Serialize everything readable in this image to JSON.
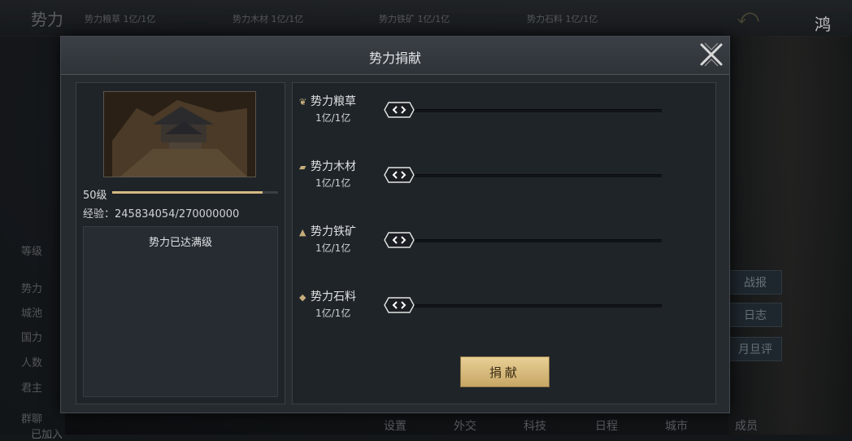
{
  "topbar": {
    "title": "势力",
    "resources": [
      {
        "name": "势力粮草",
        "value": "1亿/1亿"
      },
      {
        "name": "势力木材",
        "value": "1亿/1亿"
      },
      {
        "name": "势力铁矿",
        "value": "1亿/1亿"
      },
      {
        "name": "势力石料",
        "value": "1亿/1亿"
      }
    ]
  },
  "left_panel": {
    "labels": [
      "等级",
      "势力",
      "城池",
      "国力",
      "人数",
      "君主",
      "群聊"
    ],
    "group_chat_value": "已加入"
  },
  "side_buttons": [
    "战报",
    "日志",
    "月旦评"
  ],
  "bottom_nav": [
    "设置",
    "外交",
    "科技",
    "日程",
    "城市",
    "成员"
  ],
  "modal": {
    "title": "势力捐献",
    "level_label": "50级",
    "level_progress": 0.908,
    "exp_label": "经验：245834054/270000000",
    "status_text": "势力已达满级",
    "resources": [
      {
        "name": "势力粮草",
        "amount": "1亿/1亿",
        "icon": "grain-icon"
      },
      {
        "name": "势力木材",
        "amount": "1亿/1亿",
        "icon": "wood-icon"
      },
      {
        "name": "势力铁矿",
        "amount": "1亿/1亿",
        "icon": "iron-icon"
      },
      {
        "name": "势力石料",
        "amount": "1亿/1亿",
        "icon": "stone-icon"
      }
    ],
    "donate_label": "捐献"
  },
  "colors": {
    "accent_gold": "#d4b980",
    "button_gold": "#dcc184",
    "panel_bg": "#1f2429"
  }
}
